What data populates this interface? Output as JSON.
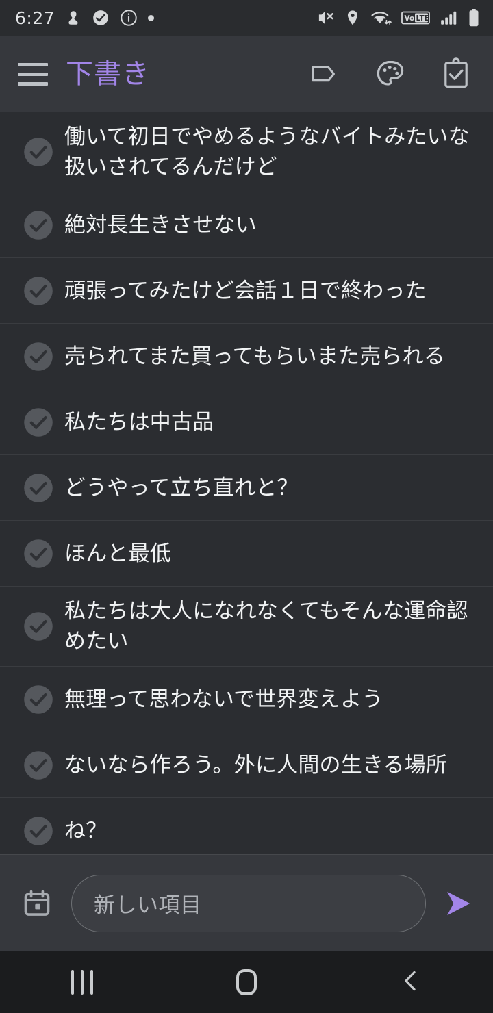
{
  "status_bar": {
    "time": "6:27",
    "left_icons": [
      "alarm-icon",
      "check-badge-icon",
      "info-icon",
      "dot-icon"
    ],
    "right_icons": [
      "mute-icon",
      "location-icon",
      "wifi-icon",
      "volte-icon",
      "signal-icon",
      "battery-icon"
    ],
    "volte_label": "VoLTE",
    "background": "#2a2c2f"
  },
  "toolbar": {
    "menu_icon": "hamburger-menu-icon",
    "title": "下書き",
    "title_color": "#a285e8",
    "actions": [
      {
        "name": "tag-icon",
        "label": "ラベル"
      },
      {
        "name": "palette-icon",
        "label": "配色"
      },
      {
        "name": "clipboard-check-icon",
        "label": "チェックリスト"
      }
    ],
    "background": "#36383d"
  },
  "list": {
    "background": "#2b2d31",
    "divider_color": "#3a3c40",
    "checkbox_icon": "check-circle-icon",
    "items": [
      {
        "text": "働いて初日でやめるようなバイトみたいな扱いされてるんだけど",
        "checked": true,
        "multiline": true
      },
      {
        "text": "絶対長生きさせない",
        "checked": true,
        "multiline": false
      },
      {
        "text": "頑張ってみたけど会話１日で終わった",
        "checked": true,
        "multiline": false
      },
      {
        "text": "売られてまた買ってもらいまた売られる",
        "checked": true,
        "multiline": false
      },
      {
        "text": "私たちは中古品",
        "checked": true,
        "multiline": false
      },
      {
        "text": "どうやって立ち直れと？",
        "checked": true,
        "multiline": false
      },
      {
        "text": "ほんと最低",
        "checked": true,
        "multiline": false
      },
      {
        "text": "私たちは大人になれなくてもそんな運命認めたい",
        "checked": true,
        "multiline": true
      },
      {
        "text": "無理って思わないで世界変えよう",
        "checked": true,
        "multiline": false
      },
      {
        "text": "ないなら作ろう。外に人間の生きる場所",
        "checked": true,
        "multiline": false
      },
      {
        "text": "ね？",
        "checked": true,
        "multiline": false
      }
    ]
  },
  "composer": {
    "calendar_icon": "calendar-icon",
    "placeholder": "新しい項目",
    "value": "",
    "send_icon": "send-arrow-icon",
    "send_color": "#a285e8",
    "background": "#36383d"
  },
  "navbar": {
    "background": "#1b1c1e",
    "buttons": [
      {
        "name": "nav-recents-button",
        "icon": "recents-icon"
      },
      {
        "name": "nav-home-button",
        "icon": "home-icon"
      },
      {
        "name": "nav-back-button",
        "icon": "back-chevron-icon"
      }
    ]
  }
}
